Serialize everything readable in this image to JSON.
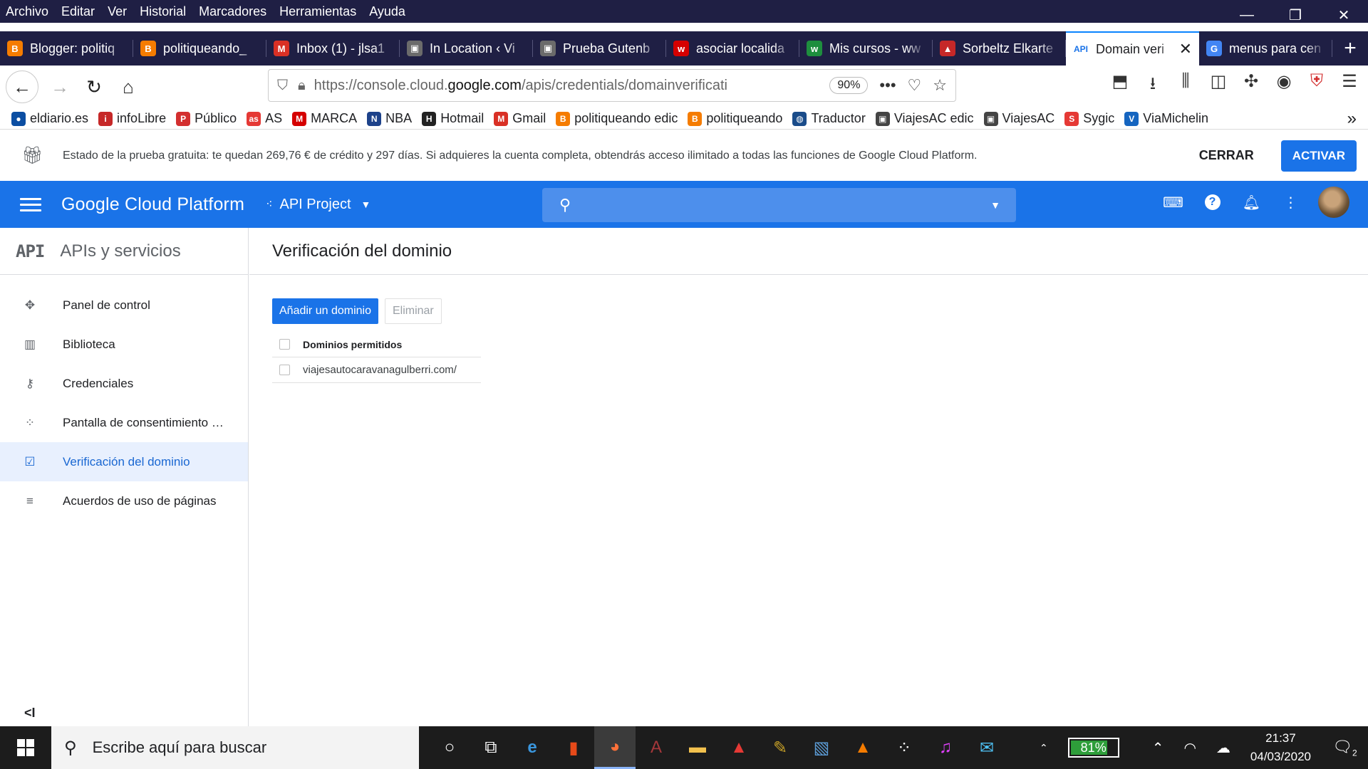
{
  "menu": [
    "Archivo",
    "Editar",
    "Ver",
    "Historial",
    "Marcadores",
    "Herramientas",
    "Ayuda"
  ],
  "tabs": [
    {
      "label": "Blogger: politiq",
      "icon": "blogger-icon",
      "color": "#f57c00",
      "glyph": "B"
    },
    {
      "label": "politiqueando_",
      "icon": "blogger-icon",
      "color": "#f57c00",
      "glyph": "B"
    },
    {
      "label": "Inbox (1) - jlsa1",
      "icon": "gmail-icon",
      "color": "#d93025",
      "glyph": "M"
    },
    {
      "label": "In Location ‹ Vi",
      "icon": "site-icon",
      "color": "#6b6b6b",
      "glyph": "▣"
    },
    {
      "label": "Prueba Gutenb",
      "icon": "site-icon",
      "color": "#6b6b6b",
      "glyph": "▣"
    },
    {
      "label": "asociar localida",
      "icon": "w-red-icon",
      "color": "#d50000",
      "glyph": "w"
    },
    {
      "label": "Mis cursos - ww",
      "icon": "w-green-icon",
      "color": "#1e8e3e",
      "glyph": "w"
    },
    {
      "label": "Sorbeltz Elkarte",
      "icon": "site-icon",
      "color": "#c62828",
      "glyph": "▲"
    },
    {
      "label": "Domain veri",
      "icon": "api-icon",
      "color": "#1a73e8",
      "glyph": "API",
      "active": true
    },
    {
      "label": "menus para cen",
      "icon": "google-icon",
      "color": "#4285f4",
      "glyph": "G"
    }
  ],
  "url": {
    "prefix": "https://console.cloud.",
    "domain": "google.com",
    "path": "/apis/credentials/domainverificati",
    "zoom": "90%"
  },
  "bookmarks": [
    {
      "label": "eldiario.es",
      "icon": "eldiario-icon",
      "color": "#0b4ea2",
      "glyph": "●"
    },
    {
      "label": "infoLibre",
      "icon": "infolibre-icon",
      "color": "#c62828",
      "glyph": "i"
    },
    {
      "label": "Público",
      "icon": "publico-icon",
      "color": "#d32f2f",
      "glyph": "P"
    },
    {
      "label": "AS",
      "icon": "as-icon",
      "color": "#e53935",
      "glyph": "as"
    },
    {
      "label": "MARCA",
      "icon": "marca-icon",
      "color": "#d50000",
      "glyph": "M"
    },
    {
      "label": "NBA",
      "icon": "nba-icon",
      "color": "#1d428a",
      "glyph": "N"
    },
    {
      "label": "Hotmail",
      "icon": "hotmail-icon",
      "color": "#222222",
      "glyph": "H"
    },
    {
      "label": "Gmail",
      "icon": "gmail-icon",
      "color": "#d93025",
      "glyph": "M"
    },
    {
      "label": "politiqueando edic",
      "icon": "blogger-icon",
      "color": "#f57c00",
      "glyph": "B"
    },
    {
      "label": "politiqueando",
      "icon": "blogger-icon",
      "color": "#f57c00",
      "glyph": "B"
    },
    {
      "label": "Traductor",
      "icon": "globe-icon",
      "color": "#1a4c8a",
      "glyph": "◍"
    },
    {
      "label": "ViajesAC edic",
      "icon": "site-icon",
      "color": "#444444",
      "glyph": "▣"
    },
    {
      "label": "ViajesAC",
      "icon": "site-icon",
      "color": "#444444",
      "glyph": "▣"
    },
    {
      "label": "Sygic",
      "icon": "sygic-icon",
      "color": "#e53935",
      "glyph": "S"
    },
    {
      "label": "ViaMichelin",
      "icon": "michelin-icon",
      "color": "#1565c0",
      "glyph": "V"
    }
  ],
  "trial": {
    "message": "Estado de la prueba gratuita: te quedan 269,76 € de crédito y 297 días. Si adquieres la cuenta completa, obtendrás acceso ilimitado a todas las funciones de Google Cloud Platform.",
    "dismiss": "CERRAR",
    "activate": "ACTIVAR"
  },
  "appbar": {
    "brand": "Google Cloud Platform",
    "project": "API Project"
  },
  "sidebar": {
    "badge": "API",
    "title": "APIs y servicios",
    "items": [
      {
        "label": "Panel de control",
        "icon": "dashboard-icon",
        "glyph": "✥"
      },
      {
        "label": "Biblioteca",
        "icon": "library-icon",
        "glyph": "▥"
      },
      {
        "label": "Credenciales",
        "icon": "key-icon",
        "glyph": "⚷"
      },
      {
        "label": "Pantalla de consentimiento …",
        "icon": "consent-icon",
        "glyph": "⁘"
      },
      {
        "label": "Verificación del dominio",
        "icon": "check-box-icon",
        "glyph": "☑",
        "active": true
      },
      {
        "label": "Acuerdos de uso de páginas",
        "icon": "settings-list-icon",
        "glyph": "≡"
      }
    ],
    "collapse": "<I"
  },
  "main": {
    "title": "Verificación del dominio",
    "add_button": "Añadir un dominio",
    "delete_button": "Eliminar",
    "table_header": "Dominios permitidos",
    "rows": [
      "viajesautocaravanagulberri.com/"
    ]
  },
  "taskbar": {
    "search_placeholder": "Escribe aquí para buscar",
    "battery": "81%",
    "battery_level": 0.81,
    "time": "21:37",
    "date": "04/03/2020",
    "notifications": "2"
  },
  "colors": {
    "primary": "#1a73e8",
    "chrome": "#1f1f44",
    "active_nav_bg": "#e8f0fe"
  }
}
